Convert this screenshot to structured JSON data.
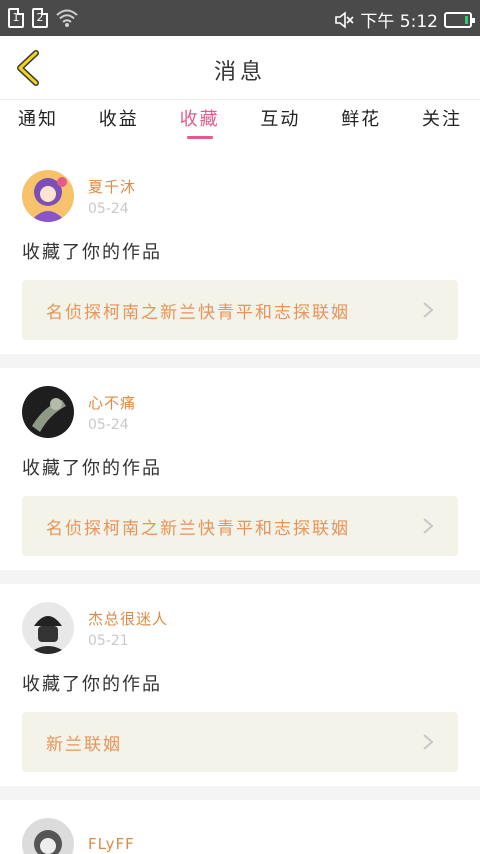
{
  "status_bar": {
    "sim1": "1",
    "sim2": "2",
    "time": "下午 5:12",
    "battery_color": "#2ecc71"
  },
  "header": {
    "title": "消息",
    "back_icon": "chevron-left-icon"
  },
  "tabs": [
    {
      "label": "通知",
      "active": false
    },
    {
      "label": "收益",
      "active": false
    },
    {
      "label": "收藏",
      "active": true
    },
    {
      "label": "互动",
      "active": false
    },
    {
      "label": "鲜花",
      "active": false
    },
    {
      "label": "关注",
      "active": false
    }
  ],
  "messages": [
    {
      "username": "夏千沐",
      "date": "05-24",
      "action": "收藏了你的作品",
      "work_title": "名侦探柯南之新兰快青平和志探联姻"
    },
    {
      "username": "心不痛",
      "date": "05-24",
      "action": "收藏了你的作品",
      "work_title": "名侦探柯南之新兰快青平和志探联姻"
    },
    {
      "username": "杰总很迷人",
      "date": "05-21",
      "action": "收藏了你的作品",
      "work_title": "新兰联姻"
    },
    {
      "username": "FLyFF",
      "date": "",
      "action": "",
      "work_title": ""
    }
  ],
  "colors": {
    "accent": "#e05a8c",
    "username": "#e08b45",
    "work_title": "#e89358",
    "work_bg": "#f3f3ea"
  }
}
